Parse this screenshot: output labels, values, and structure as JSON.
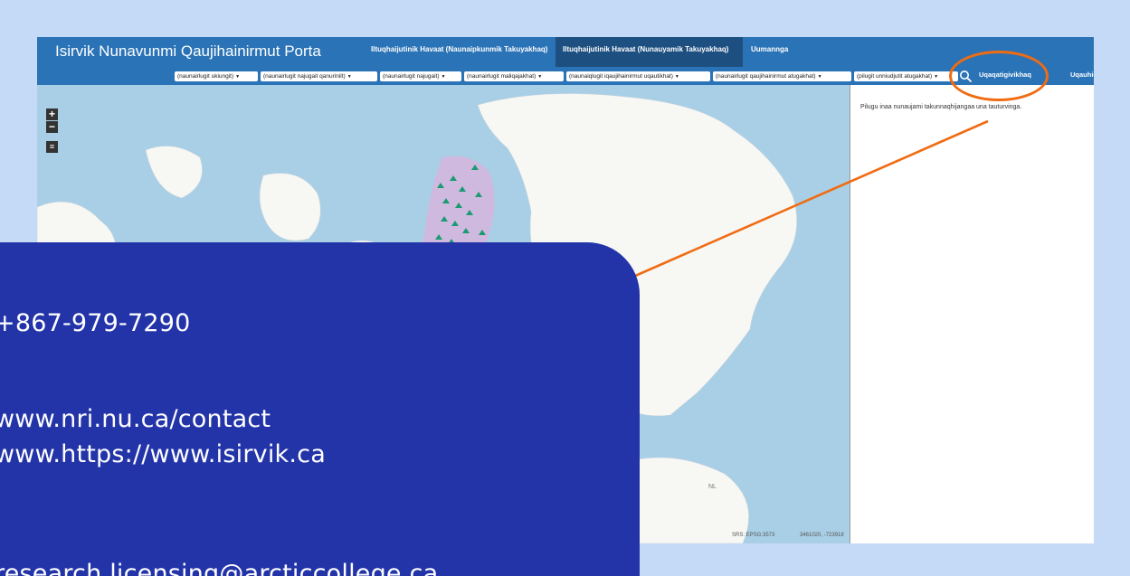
{
  "portal": {
    "title": "Isirvik Nunavunmi Qaujihainirmut Porta",
    "tabs": [
      {
        "label": "Iltuqhaijutinik Havaat (Naunaipkunmik Takuyakhaq)",
        "active": false
      },
      {
        "label": "Iltuqhaijutinik Havaat (Nunauyamik Takuyakhaq)",
        "active": true
      },
      {
        "label": "Uumannga",
        "active": false
      }
    ],
    "filters": [
      "(naunairlugit ukiungit)",
      "(naunairlugit najugait qanurinilt)",
      "(naunairlugit najugait)",
      "(naunairlugit maliqajakhat)",
      "(naunaiqlugit iqaujihainirmut uqautikhat)",
      "(naunairlugit qaujihainirmut atugakhat)",
      "(pilugit unniudjutit atugakhat)"
    ],
    "links": {
      "highlighted": "Uqaqatigivikhaq",
      "other": "Uqauhiq"
    },
    "side_panel_text": "Pilugu inaa nunaujami takunnaqhijangaa una tauturvinga.",
    "map": {
      "zoom_in": "+",
      "zoom_out": "−",
      "srs": "SRS: EPSG:3573",
      "coords": "3461020, -723918",
      "region_label": "NL"
    }
  },
  "contact": {
    "phone": "+867-979-7290",
    "web1": "www.nri.nu.ca/contact",
    "web2": "www.https://www.isirvik.ca",
    "email": "research.licensing@arcticcollege.ca"
  },
  "colors": {
    "page_background": "#c5daf7",
    "header_blue": "#2a73b6",
    "card_blue": "#2334a8",
    "highlight_orange": "#f06c13",
    "water": "#a9cfe6",
    "land": "#f7f7f4",
    "markers": "#1a9b74"
  }
}
